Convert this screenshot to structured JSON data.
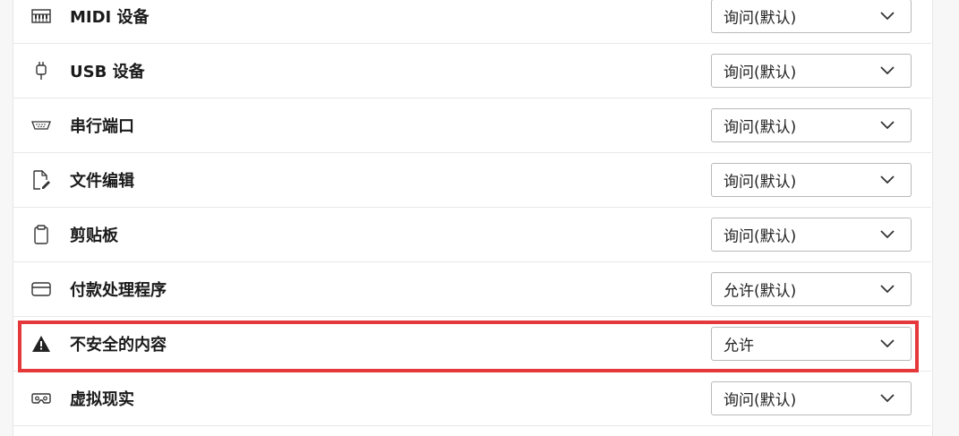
{
  "settings": [
    {
      "label": "MIDI 设备",
      "icon": "midi-keyboard-icon",
      "value": "询问(默认)"
    },
    {
      "label": "USB 设备",
      "icon": "usb-icon",
      "value": "询问(默认)"
    },
    {
      "label": "串行端口",
      "icon": "serial-port-icon",
      "value": "询问(默认)"
    },
    {
      "label": "文件编辑",
      "icon": "file-edit-icon",
      "value": "询问(默认)"
    },
    {
      "label": "剪贴板",
      "icon": "clipboard-icon",
      "value": "询问(默认)"
    },
    {
      "label": "付款处理程序",
      "icon": "credit-card-icon",
      "value": "允许(默认)"
    },
    {
      "label": "不安全的内容",
      "icon": "warning-icon",
      "value": "允许"
    },
    {
      "label": "虚拟现实",
      "icon": "vr-headset-icon",
      "value": "询问(默认)"
    }
  ],
  "highlight_color": "#e5383b"
}
